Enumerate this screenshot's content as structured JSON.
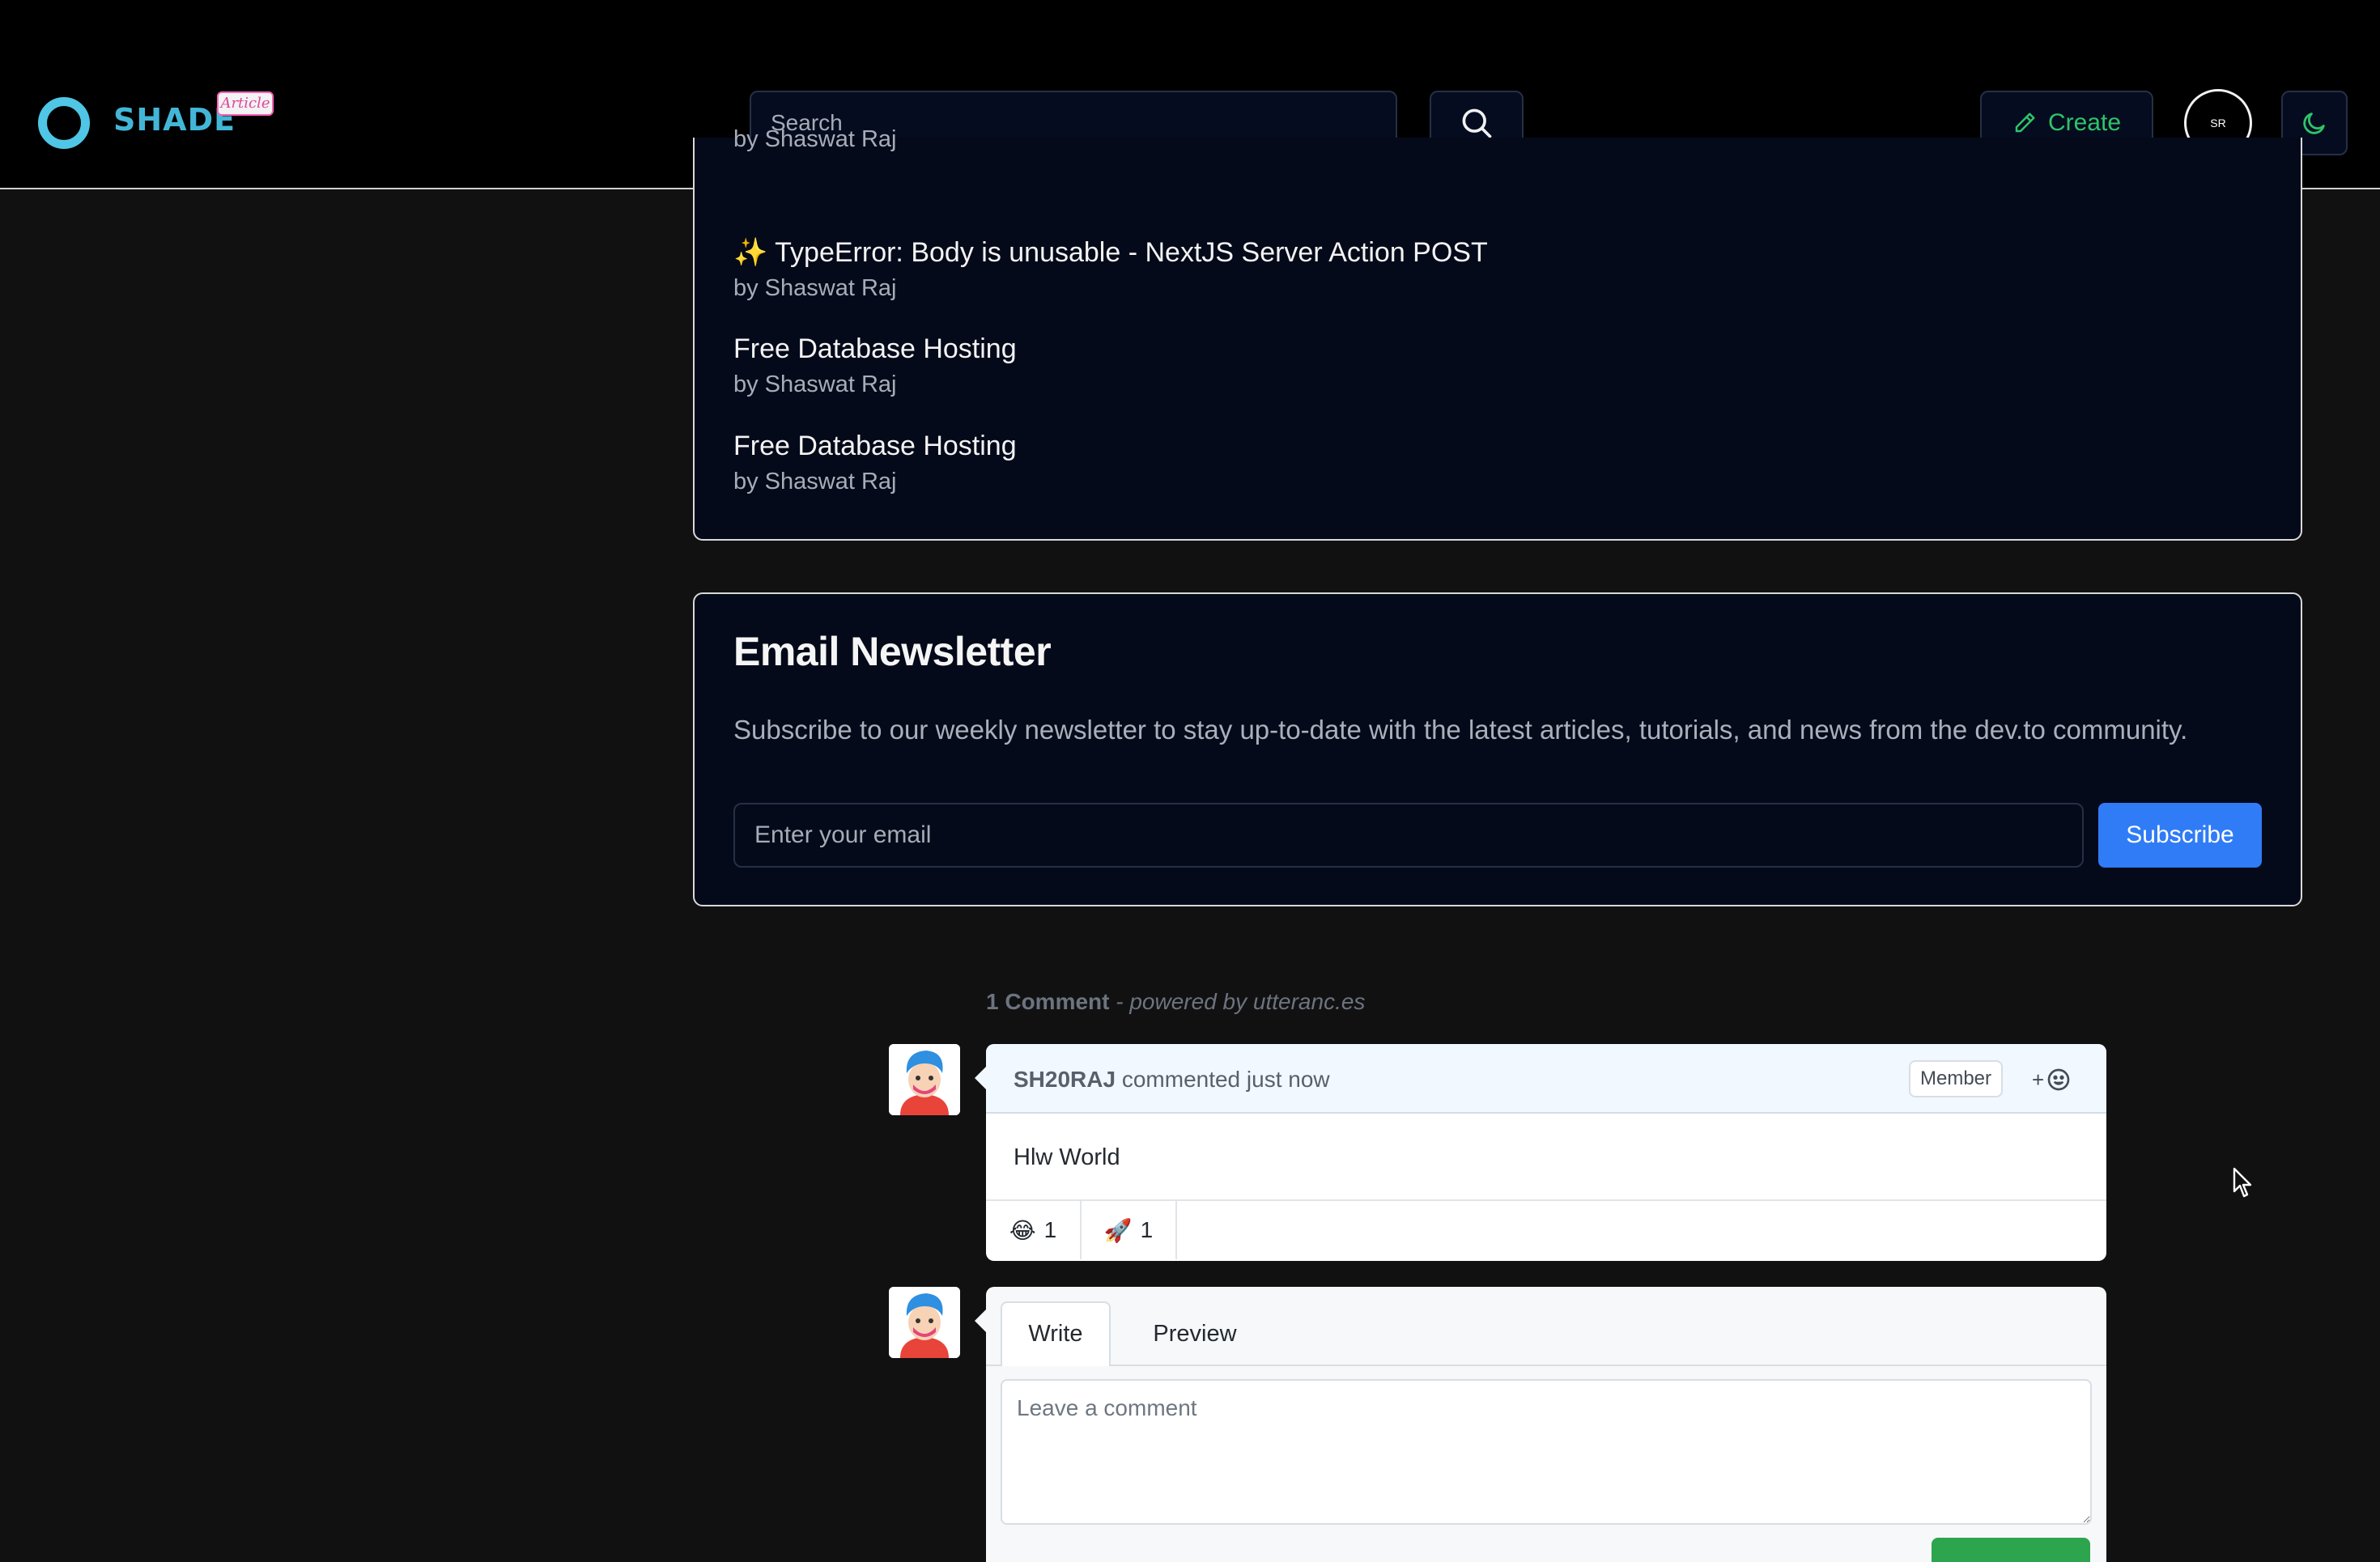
{
  "header": {
    "logo_text": "SHADE",
    "logo_badge": "Article",
    "search_placeholder": "Search",
    "create_label": "Create",
    "avatar_text": "SR"
  },
  "articles": [
    {
      "title": "",
      "author": "by Shaswat Raj"
    },
    {
      "title": "✨ TypeError: Body is unusable - NextJS Server Action POST",
      "author": "by Shaswat Raj"
    },
    {
      "title": "Free Database Hosting",
      "author": "by Shaswat Raj"
    },
    {
      "title": "Free Database Hosting",
      "author": "by Shaswat Raj"
    }
  ],
  "newsletter": {
    "title": "Email Newsletter",
    "description": "Subscribe to our weekly newsletter to stay up-to-date with the latest articles, tutorials, and news from the dev.to community.",
    "email_placeholder": "Enter your email",
    "subscribe_label": "Subscribe"
  },
  "comments": {
    "count_label": "1 Comment",
    "powered_by": "- powered by utteranc.es",
    "items": [
      {
        "author": "SH20RAJ",
        "action": "commented just now",
        "badge": "Member",
        "add_reaction": "+",
        "body": "Hlw World",
        "reactions": [
          {
            "emoji": "😂",
            "count": "1"
          },
          {
            "emoji": "🚀",
            "count": "1"
          }
        ]
      }
    ],
    "editor": {
      "tab_write": "Write",
      "tab_preview": "Preview",
      "placeholder": "Leave a comment"
    }
  },
  "colors": {
    "accent_green": "#2ec46a",
    "subscribe_blue": "#2f7cf6",
    "logo_cyan": "#4fc6e6"
  }
}
